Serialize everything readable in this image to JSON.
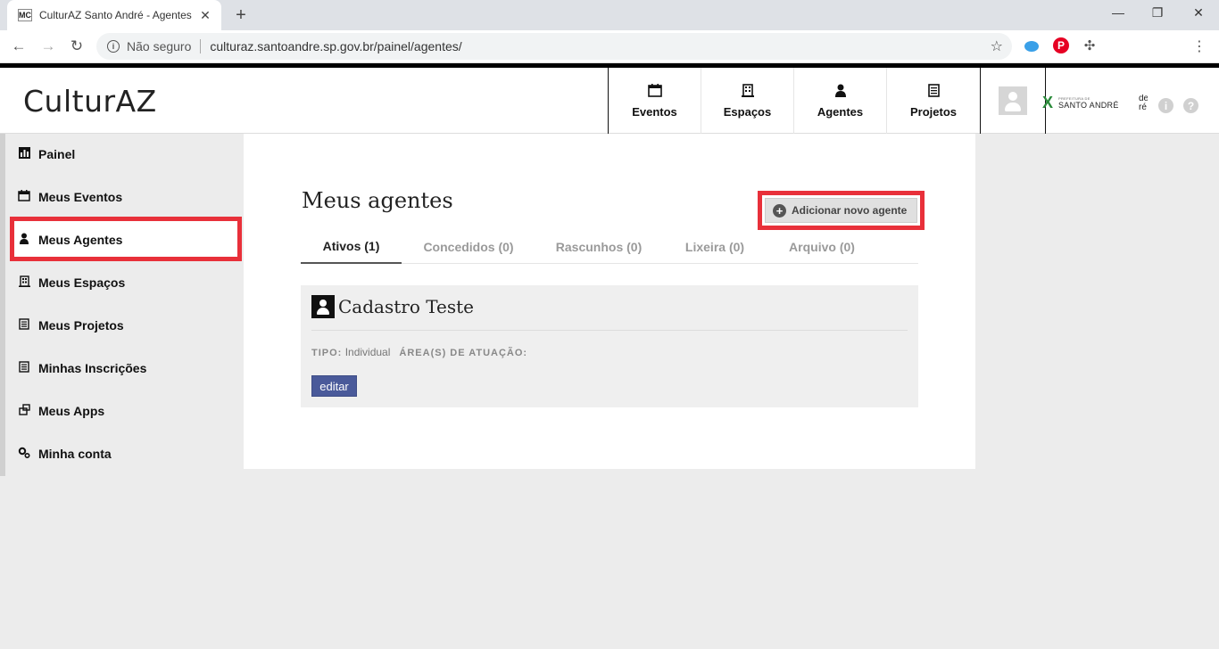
{
  "browser": {
    "tab_favicon": "MC",
    "tab_title": "CulturAZ Santo André - Agentes",
    "not_secure": "Não seguro",
    "url": "culturaz.santoandre.sp.gov.br/painel/agentes/"
  },
  "header": {
    "logo": "CulturAZ",
    "nav": [
      {
        "label": "Eventos",
        "icon": "calendar-icon"
      },
      {
        "label": "Espaços",
        "icon": "building-icon"
      },
      {
        "label": "Agentes",
        "icon": "person-icon"
      },
      {
        "label": "Projetos",
        "icon": "document-icon"
      }
    ],
    "pref_brand": "SANTO ANDRÉ",
    "pref_small": "PREFEITURA DE",
    "cut_text": "de ré"
  },
  "sidebar": {
    "items": [
      {
        "label": "Painel",
        "icon": "chart-icon"
      },
      {
        "label": "Meus Eventos",
        "icon": "calendar-icon"
      },
      {
        "label": "Meus Agentes",
        "icon": "person-icon"
      },
      {
        "label": "Meus Espaços",
        "icon": "building-icon"
      },
      {
        "label": "Meus Projetos",
        "icon": "document-icon"
      },
      {
        "label": "Minhas Inscrições",
        "icon": "document-icon"
      },
      {
        "label": "Meus Apps",
        "icon": "apps-icon"
      },
      {
        "label": "Minha conta",
        "icon": "gear-icon"
      }
    ],
    "active": "Meus Agentes"
  },
  "main": {
    "title": "Meus agentes",
    "add_button": "Adicionar novo agente",
    "tabs": [
      {
        "label": "Ativos (1)",
        "active": true
      },
      {
        "label": "Concedidos (0)",
        "active": false
      },
      {
        "label": "Rascunhos (0)",
        "active": false
      },
      {
        "label": "Lixeira (0)",
        "active": false
      },
      {
        "label": "Arquivo (0)",
        "active": false
      }
    ],
    "card": {
      "title": "Cadastro Teste",
      "tipo_label": "TIPO:",
      "tipo_value": "Individual",
      "area_label": "ÁREA(S) DE ATUAÇÃO:",
      "edit_label": "editar"
    }
  },
  "colors": {
    "highlight": "#e8303a",
    "edit_button": "#4a5a9a"
  }
}
